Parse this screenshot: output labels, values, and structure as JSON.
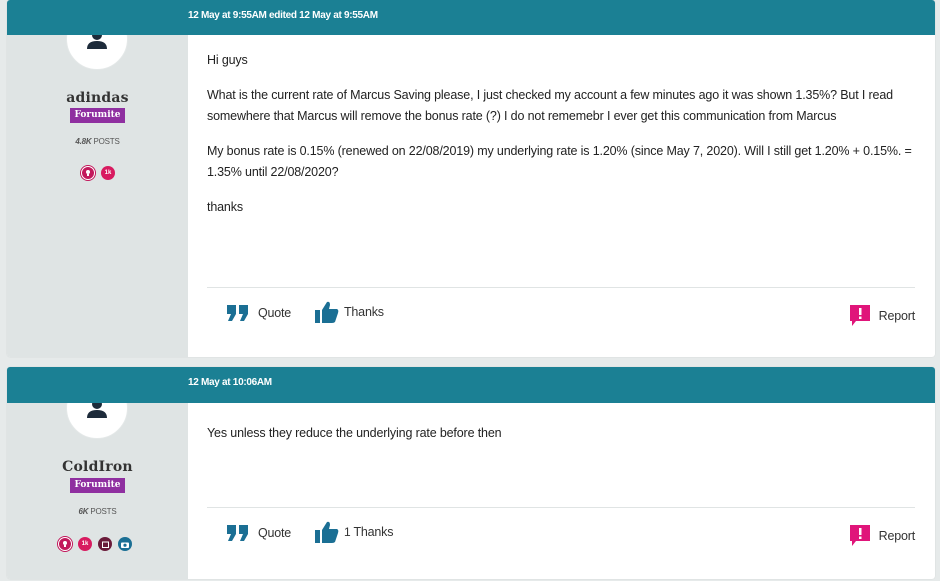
{
  "colors": {
    "header": "#1b8094",
    "sidebar": "#dfe4e4",
    "rank": "#8f2fa0",
    "report": "#e0157a"
  },
  "posts": [
    {
      "date": "12 May at 9:55AM edited 12 May at 9:55AM",
      "username": "adindas",
      "rank": "Forumite",
      "posts_count": "4.8K",
      "posts_label": "POSTS",
      "badges": [
        "insightful-badge",
        "10k-badge"
      ],
      "paragraphs": [
        "Hi guys",
        "What is the current rate of Marcus Saving please, I just checked my account a few minutes ago it was shown 1.35%? But I read somewhere that Marcus will remove the bonus rate (?) I do not rememebr I ever get this communication from Marcus",
        "My bonus rate is 0.15% (renewed on 22/08/2019) my underlying rate is 1.20% (since May 7, 2020). Will I still get 1.20% + 0.15%. = 1.35% until 22/08/2020?",
        "thanks"
      ],
      "quote_label": "Quote",
      "thanks_count": "",
      "thanks_label": "Thanks",
      "report_label": "Report"
    },
    {
      "date": "12 May at 10:06AM",
      "username": "ColdIron",
      "rank": "Forumite",
      "posts_count": "6K",
      "posts_label": "POSTS",
      "badges": [
        "insightful-badge",
        "10k-badge",
        "calendar-badge",
        "camera-badge"
      ],
      "paragraphs": [
        "Yes unless they reduce the underlying rate before then"
      ],
      "quote_label": "Quote",
      "thanks_count": "1",
      "thanks_label": "Thanks",
      "report_label": "Report"
    }
  ]
}
